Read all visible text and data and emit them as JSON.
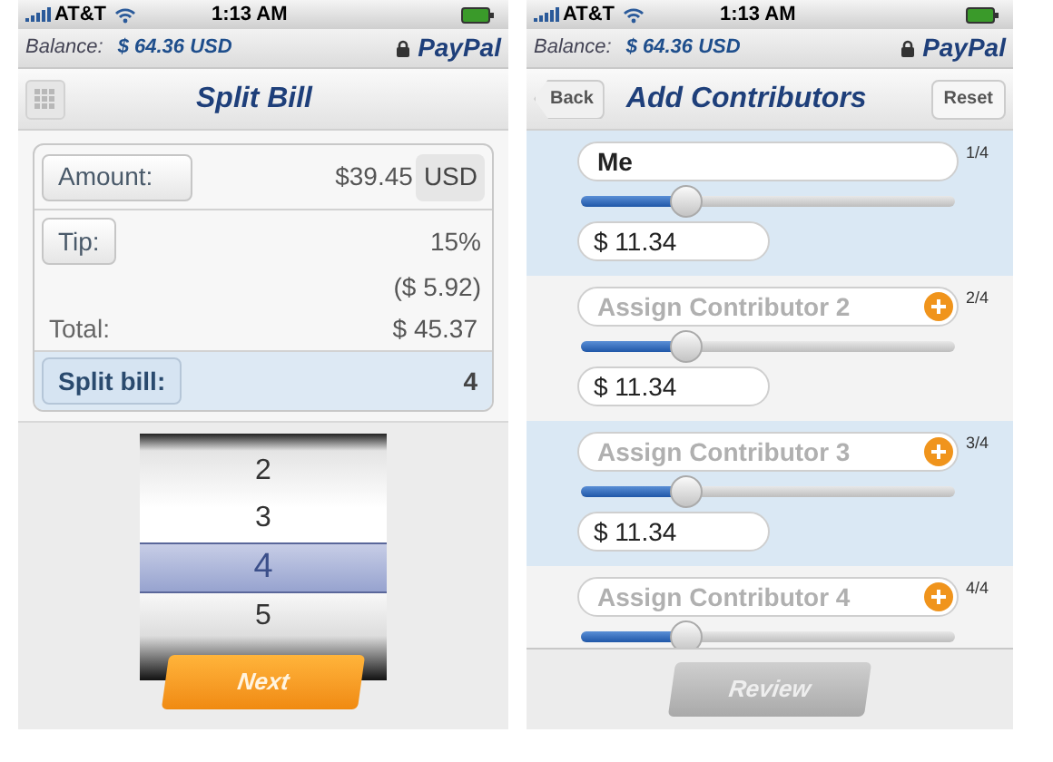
{
  "screens": [
    {
      "status_bar": {
        "carrier": "AT&T",
        "time": "1:13 AM"
      },
      "balance": {
        "label": "Balance:",
        "amount": "$ 64.36 USD",
        "brand": "PayPal"
      },
      "title": "Split Bill",
      "bill": {
        "amount_button": "Amount:",
        "amount": "$39.45",
        "currency": "USD",
        "tip_button": "Tip:",
        "tip_percent": "15%",
        "tip_amount": "($ 5.92)",
        "total_label": "Total:",
        "total": "$ 45.37",
        "split_button": "Split bill:",
        "split": "4"
      },
      "picker": [
        {
          "label": "2",
          "selected": false
        },
        {
          "label": "3",
          "selected": false
        },
        {
          "label": "4",
          "selected": true
        },
        {
          "label": "5",
          "selected": false
        }
      ],
      "action": {
        "label": "Next",
        "disabled": false
      }
    },
    {
      "status_bar": {
        "carrier": "AT&T",
        "time": "1:13 AM"
      },
      "balance": {
        "label": "Balance:",
        "amount": "$ 64.36 USD",
        "brand": "PayPal"
      },
      "title": "Add Contributors",
      "back": "Back",
      "reset": "Reset",
      "contributors": [
        {
          "name": "Me",
          "count": "1/4",
          "level": 0.28,
          "amount": "$ 11.34",
          "shaded": true
        },
        {
          "placeholder": "Assign Contributor 2",
          "count": "2/4",
          "level": 0.28,
          "amount": "$ 11.34",
          "shaded": false
        },
        {
          "placeholder": "Assign Contributor 3",
          "count": "3/4",
          "level": 0.28,
          "amount": "$ 11.34",
          "shaded": true
        },
        {
          "placeholder": "Assign Contributor 4",
          "count": "4/4",
          "level": 0.28,
          "shaded": false
        }
      ],
      "action": {
        "label": "Review",
        "disabled": true
      }
    }
  ]
}
